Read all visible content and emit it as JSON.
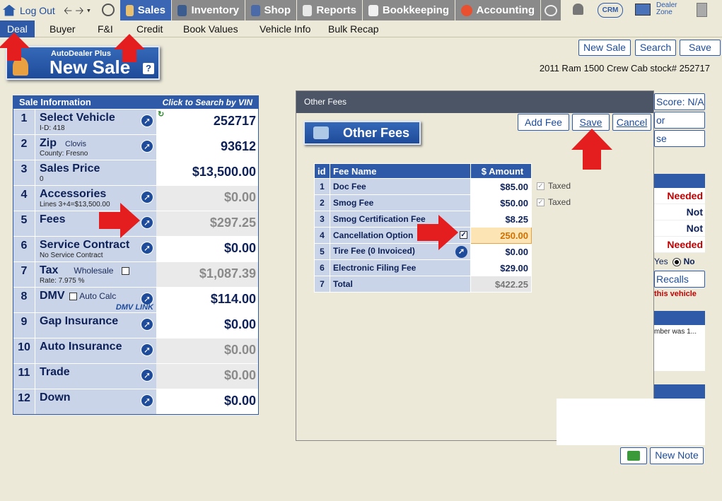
{
  "topnav": {
    "logout": "Log Out",
    "tabs": [
      {
        "label": "Sales",
        "icon": "salesperson-icon"
      },
      {
        "label": "Inventory",
        "icon": "car-icon"
      },
      {
        "label": "Shop",
        "icon": "wrench-icon"
      },
      {
        "label": "Reports",
        "icon": "report-icon"
      },
      {
        "label": "Bookkeeping",
        "icon": "book-icon"
      },
      {
        "label": "Accounting",
        "icon": "pie-chart-icon"
      }
    ],
    "crm": "CRM",
    "dealer_zone": "Dealer\nZone"
  },
  "subnav": [
    "Deal",
    "Buyer",
    "F&I",
    "Credit",
    "Book Values",
    "Vehicle Info",
    "Bulk Recap"
  ],
  "header": {
    "new_sale_btn": "New Sale",
    "search_btn": "Search",
    "save_btn": "Save",
    "logo_brand": "AutoDealer Plus",
    "logo_title": "New Sale",
    "logo_help": "?",
    "vehicle": "2011 Ram 1500 Crew Cab  stock# 252717"
  },
  "sale": {
    "header": "Sale Information",
    "header_link": "Click to Search by VIN",
    "rows": [
      {
        "num": "1",
        "label": "Select Vehicle",
        "sub": "I-D:  418",
        "value": "252717"
      },
      {
        "num": "2",
        "label": "Zip",
        "inline": "Clovis",
        "sub": "County: Fresno",
        "value": "93612"
      },
      {
        "num": "3",
        "label": "Sales Price",
        "sub": "0",
        "value": "$13,500.00"
      },
      {
        "num": "4",
        "label": "Accessories",
        "sub": "Lines 3+4=$13,500.00",
        "value": "$0.00"
      },
      {
        "num": "5",
        "label": "Fees",
        "sub": "",
        "value": "$297.25"
      },
      {
        "num": "6",
        "label": "Service Contract",
        "sub": "No Service Contract",
        "value": "$0.00"
      },
      {
        "num": "7",
        "label": "Tax",
        "inline": "Wholesale",
        "sub": "Rate: 7.975 %",
        "value": "$1,087.39"
      },
      {
        "num": "8",
        "label": "DMV",
        "inline": "Auto Calc",
        "sub": "",
        "value": "$114.00"
      },
      {
        "num": "9",
        "label": "Gap Insurance",
        "sub": "",
        "value": "$0.00"
      },
      {
        "num": "10",
        "label": "Auto Insurance",
        "sub": "",
        "value": "$0.00"
      },
      {
        "num": "11",
        "label": "Trade",
        "sub": "",
        "value": "$0.00"
      },
      {
        "num": "12",
        "label": "Down",
        "sub": "",
        "value": "$0.00"
      }
    ],
    "dmv_link": "DMV LINK"
  },
  "modal": {
    "title": "Other Fees",
    "logo": "Other Fees",
    "add_fee": "Add Fee",
    "save": "Save",
    "cancel": "Cancel",
    "columns": [
      "id",
      "Fee Name",
      "$ Amount"
    ],
    "fees": [
      {
        "id": "1",
        "name": "Doc Fee",
        "amount": "$85.00"
      },
      {
        "id": "2",
        "name": "Smog Fee",
        "amount": "$50.00"
      },
      {
        "id": "3",
        "name": "Smog Certification Fee",
        "amount": "$8.25"
      },
      {
        "id": "4",
        "name": "Cancellation Option",
        "amount": "250.00"
      },
      {
        "id": "5",
        "name": "Tire Fee (0 Invoiced)",
        "amount": "$0.00"
      },
      {
        "id": "6",
        "name": "Electronic Filing Fee",
        "amount": "$29.00"
      },
      {
        "id": "7",
        "name": "Total",
        "amount": "$422.25"
      }
    ],
    "taxed": "Taxed"
  },
  "right": {
    "score": "Score:  N/A",
    "btn2": "or",
    "btn3": "se",
    "status": [
      "Needed",
      "Not Needed",
      "Not Needed",
      "Needed"
    ],
    "yes": "Yes",
    "no": "No",
    "recalls": "Recalls",
    "vehicle_note": "this vehicle",
    "number_note": "mber was 1..."
  },
  "notes": {
    "new_note": "New Note"
  }
}
